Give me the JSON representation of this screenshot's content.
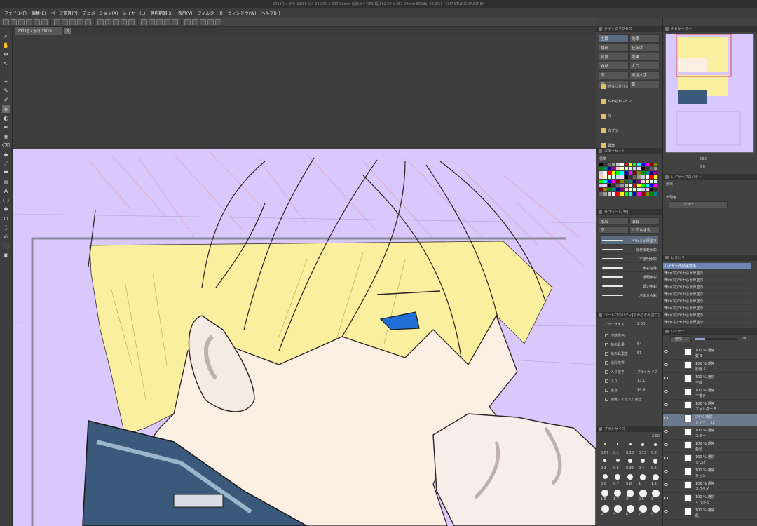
{
  "window": {
    "title": "2023らくがき 19/19 (A4 210.00 x 297.00mm 解像サイズ65 幅 182.00 x 257.00mm 600dpi 58.0%) - CLIP STUDIO PAINT EX"
  },
  "menu": [
    "ファイル(F)",
    "編集(E)",
    "ページ管理(P)",
    "アニメーション(A)",
    "レイヤー(L)",
    "選択範囲(S)",
    "表示(V)",
    "フィルター(I)",
    "ウィンドウ(W)",
    "ヘルプ(H)"
  ],
  "document_tab": {
    "label": "2023らくがき 19/19",
    "close": "×"
  },
  "quick_access": {
    "header": "クイックアクセス",
    "cells": [
      [
        "主線",
        "効果"
      ],
      [
        "描画",
        "仕上げ"
      ],
      [
        "背景",
        "効果"
      ],
      [
        "自然",
        "人口"
      ],
      [
        "面",
        "描き文字"
      ],
      [
        "面",
        "髪"
      ]
    ],
    "selected": "主線"
  },
  "sub_tool": {
    "items": [
      "さらっきペン",
      "やわらかGペン",
      "丸",
      "カブラ",
      "細筆"
    ],
    "tabs": [
      "水彩",
      "油彩",
      "厚",
      "リアル水彩"
    ],
    "brushes": [
      "やわらか厚塗り",
      "混ぜる乾水彩",
      "不透明水彩",
      "水彩境界",
      "透明水彩",
      "濃い水彩",
      "滲ませ水彩"
    ],
    "header": "サブツール[筆]"
  },
  "color_set": {
    "header": "カラーセット",
    "name": "標準"
  },
  "tool_property": {
    "header": "ツールプロパティ[やわらか厚塗り]",
    "brush_size_label": "ブラシサイズ",
    "brush_size": "2.00",
    "items": [
      {
        "label": "下地混色",
        "value": ""
      },
      {
        "label": "絵の具量",
        "value": "54"
      },
      {
        "label": "絵の具濃度",
        "value": "51"
      },
      {
        "label": "水彩境界",
        "value": ""
      },
      {
        "label": "入り抜き",
        "value": "ブラシサイズ"
      },
      {
        "label": "入り",
        "value": "13.1"
      },
      {
        "label": "抜き",
        "value": "14.9"
      },
      {
        "label": "速度による入り抜き",
        "value": ""
      }
    ]
  },
  "brush_size_panel": {
    "header": "ブラシサイズ",
    "value": "2.00",
    "sizes": [
      "0.07",
      "0.1",
      "0.13",
      "0.15",
      "0.2",
      "0.3",
      "0.5",
      "0.35",
      "0.4",
      "0.5",
      "0.6",
      "0.7",
      "0.8",
      "1",
      "1.2",
      "1.5",
      "1.7",
      "2",
      "2.5",
      "3",
      "4",
      "5",
      "6",
      "7",
      "8"
    ]
  },
  "navigator": {
    "header": "ナビゲーター",
    "zoom": "58.0",
    "rotate": "0.0"
  },
  "layer_property": {
    "header": "レイヤープロパティ",
    "effect_label": "効果",
    "expression_label": "表現色",
    "expression_value": "カラー"
  },
  "history": {
    "header": "ヒストリー",
    "items": [
      "レイヤーの順序変更",
      "筆(水彩)/やわらか厚塗り",
      "筆(水彩)/やわらか厚塗り",
      "筆(水彩)/やわらか厚塗り",
      "筆(水彩)/やわらか厚塗り",
      "筆(水彩)/やわらか厚塗り",
      "筆(水彩)/やわらか厚塗り",
      "筆(水彩)/やわらか厚塗り",
      "筆(水彩)/やわらか厚塗り"
    ]
  },
  "layers": {
    "header": "レイヤー",
    "blend": "通常",
    "opacity": "24",
    "items": [
      {
        "l1": "100 % 通常",
        "l2": "髪 3",
        "selected": false
      },
      {
        "l1": "100 % 通常",
        "l2": "影線 5",
        "selected": false
      },
      {
        "l1": "100 % 通常",
        "l2": "主線",
        "selected": false
      },
      {
        "l1": "100 % 通常",
        "l2": "下書き",
        "selected": false
      },
      {
        "l1": "100 % 通常",
        "l2": "フォルダー 5",
        "selected": false
      },
      {
        "l1": "24 % 通常",
        "l2": "レイヤー 12",
        "selected": true
      },
      {
        "l1": "100 % 通常",
        "l2": "カラー",
        "selected": false
      },
      {
        "l1": "100 % 通常",
        "l2": "金髪",
        "selected": false
      },
      {
        "l1": "100 % 通常",
        "l2": "まつげ",
        "selected": false
      },
      {
        "l1": "100 % 通常",
        "l2": "ひとみ",
        "selected": false
      },
      {
        "l1": "100 % 通常",
        "l2": "ネクタイ",
        "selected": false
      },
      {
        "l1": "100 % 通常",
        "l2": "くちびる",
        "selected": false
      },
      {
        "l1": "100 % 通常",
        "l2": "肌",
        "selected": false
      }
    ]
  },
  "colors": {
    "canvas_bg": "#d9c8fb",
    "hair": "#f9ef9f",
    "skin": "#fbeee2",
    "uniform": "#3b5a7b",
    "eye": "#1f6fd6",
    "accent_selection": "#6f86b6"
  }
}
